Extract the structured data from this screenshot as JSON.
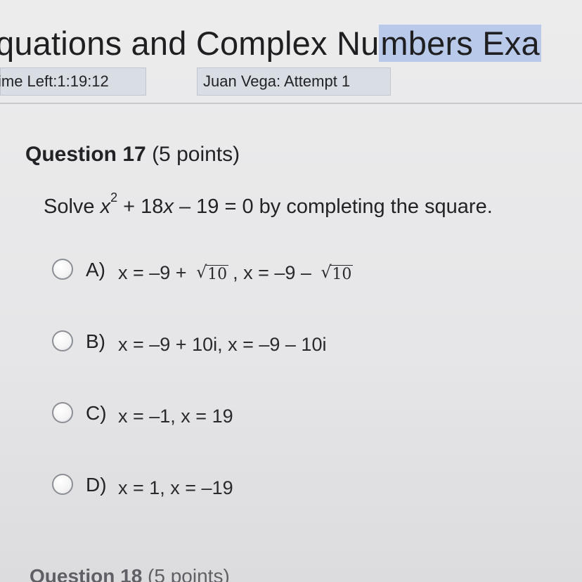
{
  "header": {
    "title_part1": "quations and Complex Nu",
    "title_part2": "mbers Exa",
    "time_left": "ime Left:1:19:12",
    "attempt": "Juan Vega: Attempt 1"
  },
  "question": {
    "number_label": "Question 17",
    "points": "(5 points)",
    "prompt_pre": "Solve ",
    "prompt_var1": "x",
    "prompt_exp": "2",
    "prompt_mid": " + 18",
    "prompt_var2": "x",
    "prompt_post": " – 19 = 0 by completing the square.",
    "options": [
      {
        "letter": "A)",
        "part1": "x = –9 + ",
        "sqrt1": "10",
        "part2": ", x = –9 – ",
        "sqrt2": "10"
      },
      {
        "letter": "B)",
        "text": "x = –9 + 10i, x = –9 – 10i"
      },
      {
        "letter": "C)",
        "text": "x = –1, x = 19"
      },
      {
        "letter": "D)",
        "text": "x = 1, x = –19"
      }
    ]
  },
  "next_question": {
    "number_label": "Question 18",
    "points": "(5 points)"
  },
  "colors": {
    "highlight": "#b9c9ea",
    "meta_box": "#d9dde4",
    "text": "#222326"
  },
  "icons": {
    "radio": "radio-button-unselected"
  }
}
